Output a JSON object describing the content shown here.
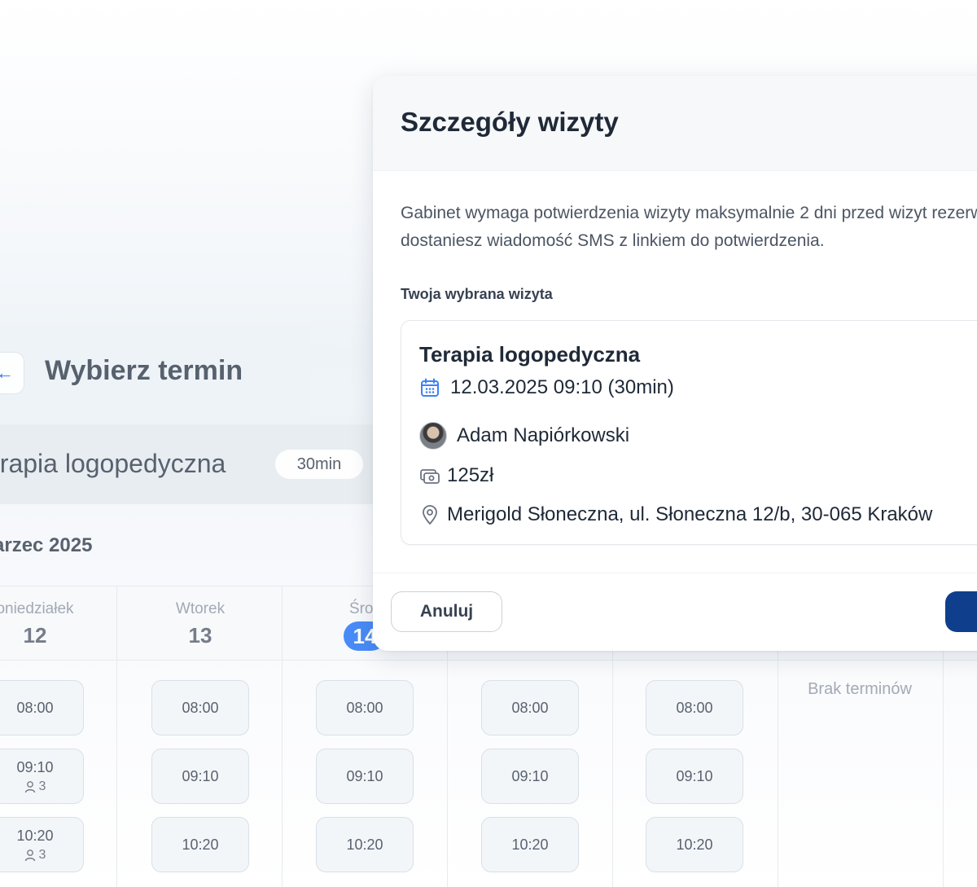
{
  "background": {
    "page_title": "Wybierz termin",
    "service": {
      "name": "erapia logopedyczna",
      "duration": "30min"
    },
    "month": "arzec 2025",
    "days": [
      {
        "name": "oniedziałek",
        "number": "12"
      },
      {
        "name": "Wtorek",
        "number": "13"
      },
      {
        "name": "Środ",
        "number": "14"
      },
      {
        "name": "",
        "number": ""
      },
      {
        "name": "",
        "number": ""
      },
      {
        "name": "",
        "number": ""
      }
    ],
    "slots": {
      "col1": [
        {
          "time": "08:00",
          "capacity": ""
        },
        {
          "time": "09:10",
          "capacity": "3"
        },
        {
          "time": "10:20",
          "capacity": "3"
        }
      ],
      "col2": [
        {
          "time": "08:00"
        },
        {
          "time": "09:10"
        },
        {
          "time": "10:20"
        }
      ],
      "col3": [
        {
          "time": "08:00"
        },
        {
          "time": "09:10"
        },
        {
          "time": "10:20"
        }
      ],
      "col4": [
        {
          "time": "08:00"
        },
        {
          "time": "09:10"
        },
        {
          "time": "10:20"
        }
      ],
      "col5": [
        {
          "time": "08:00"
        },
        {
          "time": "09:10"
        },
        {
          "time": "10:20"
        }
      ]
    },
    "no_slots_text": "Brak terminów"
  },
  "modal": {
    "title": "Szczegóły wizyty",
    "description": "Gabinet wymaga potwierdzenia wizyty maksymalnie 2 dni przed wizyt rezerwacji, dostaniesz wiadomość SMS z linkiem do potwierdzenia.",
    "section_label": "Twoja wybrana wizyta",
    "visit": {
      "service": "Terapia logopedyczna",
      "datetime": "12.03.2025 09:10 (30min)",
      "specialist": "Adam Napiórkowski",
      "price": "125zł",
      "location": "Merigold Słoneczna, ul. Słoneczna 12/b, 30-065 Kraków"
    },
    "cancel_label": "Anuluj",
    "confirm_label": ""
  },
  "colors": {
    "accent": "#3b82f6",
    "primary_button": "#0f3f8c",
    "calendar_icon": "#3b82f6"
  },
  "icons": [
    "back-arrow-icon",
    "calendar-icon",
    "money-icon",
    "location-pin-icon",
    "person-icon"
  ]
}
